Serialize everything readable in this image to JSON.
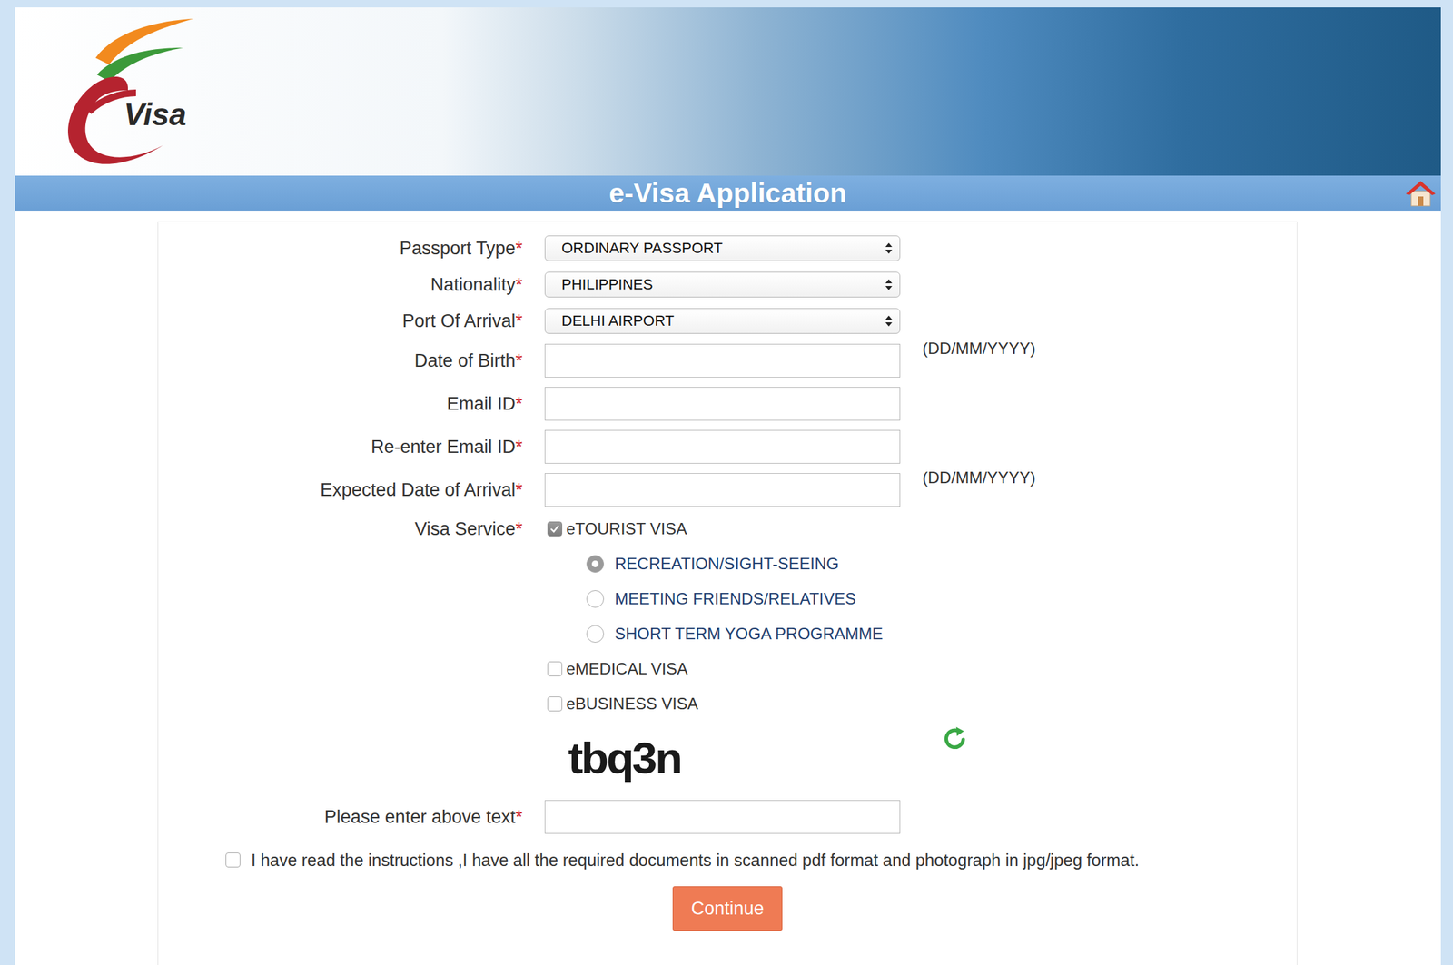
{
  "logo": {
    "text": "Visa"
  },
  "header": {
    "title": "e-Visa Application"
  },
  "required_mark": "*",
  "fields": [
    {
      "label": "Passport Type",
      "required": true,
      "kind": "select",
      "value": "ORDINARY PASSPORT"
    },
    {
      "label": "Nationality",
      "required": true,
      "kind": "select",
      "value": "PHILIPPINES"
    },
    {
      "label": "Port Of Arrival",
      "required": true,
      "kind": "select",
      "value": "DELHI AIRPORT"
    },
    {
      "label": "Date of Birth",
      "required": true,
      "kind": "text",
      "value": "",
      "hint": "(DD/MM/YYYY)"
    },
    {
      "label": "Email ID",
      "required": true,
      "kind": "text",
      "value": ""
    },
    {
      "label": "Re-enter Email ID",
      "required": true,
      "kind": "text",
      "value": ""
    },
    {
      "label": "Expected Date of Arrival",
      "required": true,
      "kind": "text",
      "value": "",
      "hint": "(DD/MM/YYYY)"
    }
  ],
  "visa_service": {
    "label": "Visa Service",
    "required": true,
    "options": [
      {
        "label": "eTOURIST VISA",
        "checked": true,
        "purposes": [
          {
            "label": "RECREATION/SIGHT-SEEING",
            "selected": true
          },
          {
            "label": "MEETING FRIENDS/RELATIVES",
            "selected": false
          },
          {
            "label": "SHORT TERM YOGA PROGRAMME",
            "selected": false
          }
        ]
      },
      {
        "label": "eMEDICAL VISA",
        "checked": false,
        "purposes": []
      },
      {
        "label": "eBUSINESS VISA",
        "checked": false,
        "purposes": []
      }
    ]
  },
  "captcha": {
    "text": "tbq3n"
  },
  "captcha_input": {
    "label": "Please enter above text",
    "required": true,
    "value": ""
  },
  "consent": {
    "label": "I have read the instructions ,I have all the required documents in scanned pdf format and photograph in jpg/jpeg format.",
    "checked": false
  },
  "buttons": [
    "Continue"
  ]
}
